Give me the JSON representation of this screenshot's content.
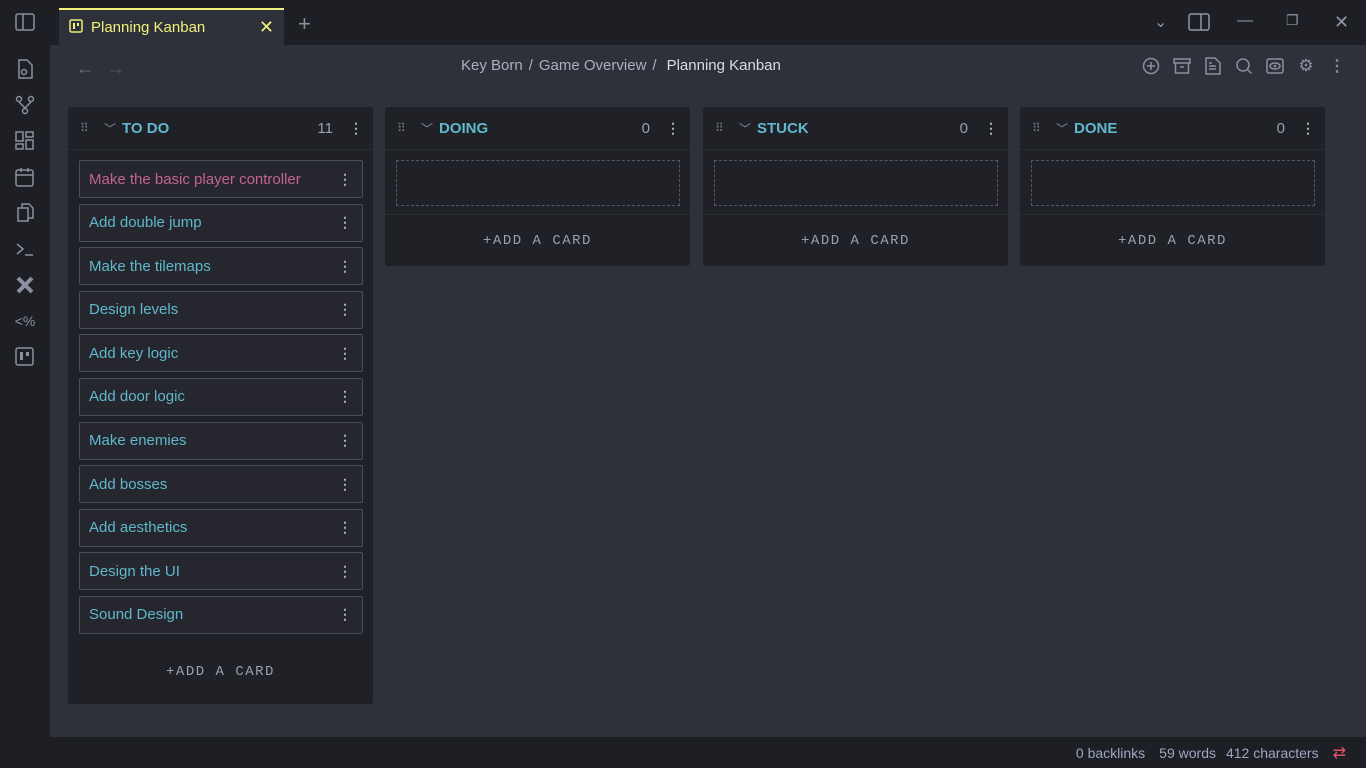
{
  "tab": {
    "title": "Planning Kanban",
    "close": "✕",
    "new": "+"
  },
  "breadcrumb": [
    "Key Born",
    "/",
    "Game Overview",
    "/",
    "Planning Kanban"
  ],
  "lanes": [
    {
      "title": "TO DO",
      "count": "11",
      "cards": [
        "Make the basic player controller",
        "Add double jump",
        "Make the tilemaps",
        "Design levels",
        "Add key logic",
        "Add door logic",
        "Make enemies",
        "Add bosses",
        "Add aesthetics",
        "Design the UI",
        "Sound Design"
      ],
      "add": "+ADD A CARD"
    },
    {
      "title": "DOING",
      "count": "0",
      "add": "+ADD A CARD"
    },
    {
      "title": "STUCK",
      "count": "0",
      "add": "+ADD A CARD"
    },
    {
      "title": "DONE",
      "count": "0",
      "add": "+ADD A CARD"
    }
  ],
  "status": {
    "backlinks": "0 backlinks",
    "words": "59 words",
    "characters": "412 characters"
  },
  "colors": {
    "accent": "#5fb8cc",
    "highlight": "#c2648c",
    "tab": "#f0f07a"
  }
}
